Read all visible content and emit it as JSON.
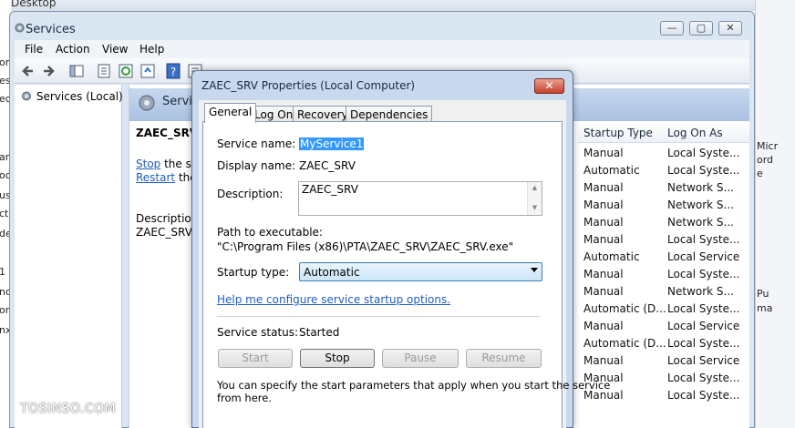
{
  "desktop": {
    "title": "Desktop"
  },
  "window": {
    "title": "Services",
    "menu": [
      "File",
      "Action",
      "View",
      "Help"
    ],
    "controls": {
      "minimize": "—",
      "maximize": "▢",
      "close": "✕"
    }
  },
  "tree": {
    "root_label": "Services (Local)"
  },
  "content": {
    "header": "Servic",
    "selected_service": "ZAEC_SRV",
    "stop_link": "Stop",
    "stop_rest": " the se",
    "restart_link": "Restart",
    "restart_rest": " the ",
    "description_label": "Description",
    "description_value": "ZAEC_SRV"
  },
  "services_list": {
    "columns": [
      "Startup Type",
      "Log On As"
    ],
    "rows": [
      {
        "startup": "Manual",
        "logon": "Local Syste..."
      },
      {
        "startup": "Automatic",
        "logon": "Local Syste..."
      },
      {
        "startup": "Manual",
        "logon": "Network S..."
      },
      {
        "startup": "Manual",
        "logon": "Network S..."
      },
      {
        "startup": "Manual",
        "logon": "Network S..."
      },
      {
        "startup": "Manual",
        "logon": "Local Syste..."
      },
      {
        "startup": "Automatic",
        "logon": "Local Service"
      },
      {
        "startup": "Manual",
        "logon": "Local Syste..."
      },
      {
        "startup": "Manual",
        "logon": "Network S..."
      },
      {
        "startup": "Automatic (D...",
        "logon": "Local Syste..."
      },
      {
        "startup": "Manual",
        "logon": "Local Service"
      },
      {
        "startup": "Automatic (D...",
        "logon": "Local Syste..."
      },
      {
        "startup": "Manual",
        "logon": "Local Service"
      },
      {
        "startup": "Manual",
        "logon": "Local Syste..."
      },
      {
        "startup": "Manual",
        "logon": "Local Syste..."
      }
    ]
  },
  "background_right": [
    "Micr",
    "ord",
    "e",
    "Pu",
    "ma"
  ],
  "background_left": [
    "ori",
    "est",
    "ec",
    "ar",
    "oc",
    "us",
    "ct",
    "de",
    "1",
    "no",
    "on",
    "nx"
  ],
  "dialog": {
    "title": "ZAEC_SRV Properties (Local Computer)",
    "close": "✕",
    "tabs": [
      "General",
      "Log On",
      "Recovery",
      "Dependencies"
    ],
    "active_tab": "General",
    "service_name_label": "Service name:",
    "service_name_value": "MyService1",
    "display_name_label": "Display name:",
    "display_name_value": "ZAEC_SRV",
    "description_label": "Description:",
    "description_value": "ZAEC_SRV",
    "path_label": "Path to executable:",
    "path_value": "\"C:\\Program Files (x86)\\PTA\\ZAEC_SRV\\ZAEC_SRV.exe\"",
    "startup_type_label": "Startup type:",
    "startup_type_value": "Automatic",
    "help_link": "Help me configure service startup options.",
    "status_label": "Service status:",
    "status_value": "Started",
    "buttons": {
      "start": "Start",
      "stop": "Stop",
      "pause": "Pause",
      "resume": "Resume"
    },
    "note_line1": "You can specify the start parameters that apply when you start the service",
    "note_line2": "from here."
  },
  "watermark": "TOSINSO.COM"
}
